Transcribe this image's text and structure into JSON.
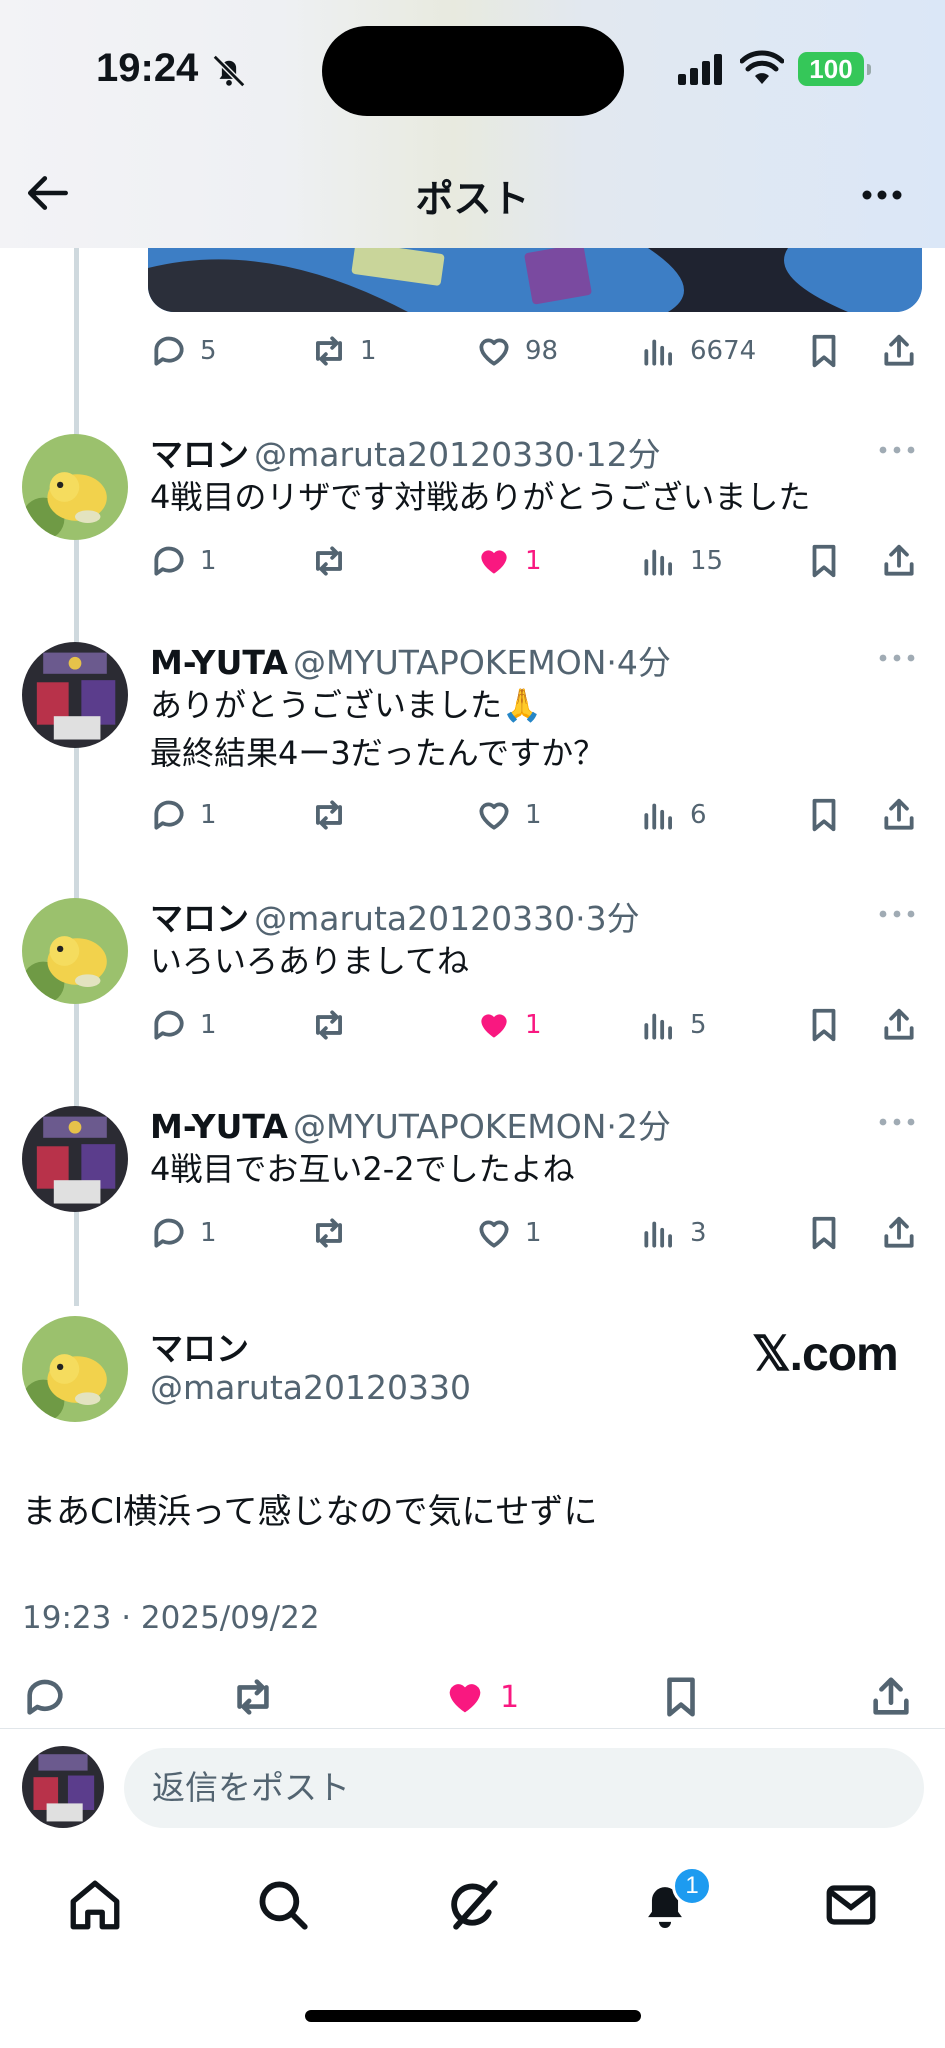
{
  "status_bar": {
    "time": "19:24",
    "battery": "100"
  },
  "header": {
    "title": "ポスト"
  },
  "top_post_stats": {
    "replies": "5",
    "reposts": "1",
    "likes": "98",
    "views": "6674"
  },
  "replies": [
    {
      "name": "マロン",
      "handle": "@maruta20120330",
      "sep": "·",
      "time": "12分",
      "text": "4戦目のリザです対戦ありがとうございました",
      "replies": "1",
      "likes": "1",
      "liked": true,
      "views": "15"
    },
    {
      "name": "M-YUTA",
      "handle": "@MYUTAPOKEMON",
      "sep": "·",
      "time": "4分",
      "text": "ありがとうございました🙏",
      "text2": "最終結果4ー3だったんですか？",
      "replies": "1",
      "likes": "1",
      "liked": false,
      "views": "6"
    },
    {
      "name": "マロン",
      "handle": "@maruta20120330",
      "sep": "·",
      "time": "3分",
      "text": "いろいろありましてね",
      "replies": "1",
      "likes": "1",
      "liked": true,
      "views": "5"
    },
    {
      "name": "M-YUTA",
      "handle": "@MYUTAPOKEMON",
      "sep": "·",
      "time": "2分",
      "text": "4戦目でお互い2-2でしたよね",
      "replies": "1",
      "likes": "1",
      "liked": false,
      "views": "3"
    }
  ],
  "main_post": {
    "name": "マロン",
    "handle": "@maruta20120330",
    "watermark": "𝕏.com",
    "text": "まあCl横浜って感じなので気にせずに",
    "timestamp": "19:23 · 2025/09/22",
    "likes": "1"
  },
  "reply_bar": {
    "placeholder": "返信をポスト"
  },
  "nav": {
    "notification_count": "1"
  },
  "colors": {
    "like": "#f91880",
    "accent": "#1d9bf0",
    "muted": "#536471"
  }
}
